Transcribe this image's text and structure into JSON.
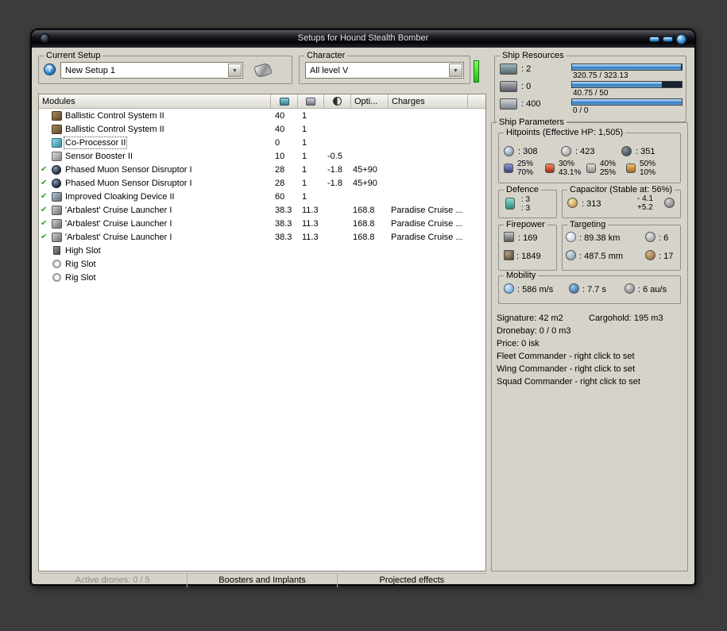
{
  "window": {
    "title": "Setups for Hound Stealth Bomber"
  },
  "current_setup": {
    "label": "Current Setup",
    "value": "New Setup 1"
  },
  "character": {
    "label": "Character",
    "value": "All level V"
  },
  "ship_resources": {
    "label": "Ship Resources",
    "rows": [
      {
        "icon": "cpu-icon",
        "value": ": 2",
        "bar_text": "320.75 / 323.13",
        "fill_pct": 99
      },
      {
        "icon": "powergrid-icon",
        "value": ": 0",
        "bar_text": "40.75 / 50",
        "fill_pct": 82
      },
      {
        "icon": "calibration-icon",
        "value": ": 400",
        "bar_text": "0 / 0",
        "fill_pct": 100
      }
    ]
  },
  "modules_panel": {
    "header": {
      "modules": "Modules",
      "opti": "Opti...",
      "charges": "Charges"
    },
    "rows": [
      {
        "checked": false,
        "selected": false,
        "icon": "bcs",
        "name": "Ballistic Control System II",
        "cpu": "40",
        "pg": "1",
        "misc": "",
        "opti": "",
        "charge": ""
      },
      {
        "checked": false,
        "selected": false,
        "icon": "bcs",
        "name": "Ballistic Control System II",
        "cpu": "40",
        "pg": "1",
        "misc": "",
        "opti": "",
        "charge": ""
      },
      {
        "checked": false,
        "selected": true,
        "icon": "coproc",
        "name": "Co-Processor II",
        "cpu": "0",
        "pg": "1",
        "misc": "",
        "opti": "",
        "charge": ""
      },
      {
        "checked": false,
        "selected": false,
        "icon": "sensor",
        "name": "Sensor Booster II",
        "cpu": "10",
        "pg": "1",
        "misc": "-0.5",
        "opti": "",
        "charge": ""
      },
      {
        "checked": true,
        "selected": false,
        "icon": "disruptor",
        "name": "Phased Muon Sensor Disruptor I",
        "cpu": "28",
        "pg": "1",
        "misc": "-1.8",
        "opti": "45+90",
        "charge": ""
      },
      {
        "checked": true,
        "selected": false,
        "icon": "disruptor",
        "name": "Phased Muon Sensor Disruptor I",
        "cpu": "28",
        "pg": "1",
        "misc": "-1.8",
        "opti": "45+90",
        "charge": ""
      },
      {
        "checked": true,
        "selected": false,
        "icon": "cloak",
        "name": "Improved Cloaking Device II",
        "cpu": "60",
        "pg": "1",
        "misc": "",
        "opti": "",
        "charge": ""
      },
      {
        "checked": true,
        "selected": false,
        "icon": "launcher",
        "name": "'Arbalest' Cruise Launcher I",
        "cpu": "38.3",
        "pg": "11.3",
        "misc": "",
        "opti": "168.8",
        "charge": "Paradise Cruise ..."
      },
      {
        "checked": true,
        "selected": false,
        "icon": "launcher",
        "name": "'Arbalest' Cruise Launcher I",
        "cpu": "38.3",
        "pg": "11.3",
        "misc": "",
        "opti": "168.8",
        "charge": "Paradise Cruise ..."
      },
      {
        "checked": true,
        "selected": false,
        "icon": "launcher",
        "name": "'Arbalest' Cruise Launcher I",
        "cpu": "38.3",
        "pg": "11.3",
        "misc": "",
        "opti": "168.8",
        "charge": "Paradise Cruise ..."
      },
      {
        "checked": false,
        "selected": false,
        "icon": "highslot",
        "name": "High Slot",
        "cpu": "",
        "pg": "",
        "misc": "",
        "opti": "",
        "charge": ""
      },
      {
        "checked": false,
        "selected": false,
        "icon": "rig",
        "name": "Rig Slot",
        "cpu": "",
        "pg": "",
        "misc": "",
        "opti": "",
        "charge": ""
      },
      {
        "checked": false,
        "selected": false,
        "icon": "rig",
        "name": "Rig Slot",
        "cpu": "",
        "pg": "",
        "misc": "",
        "opti": "",
        "charge": ""
      }
    ],
    "footer_tabs": [
      {
        "label": "Active drones: 0 / 5",
        "disabled": true
      },
      {
        "label": "Boosters and Implants",
        "disabled": false
      },
      {
        "label": "Projected effects",
        "disabled": false
      }
    ]
  },
  "ship_parameters": {
    "label": "Ship Parameters",
    "hitpoints": {
      "label": "Hitpoints (Effective HP: 1,505)",
      "shield": ": 308",
      "armor": ": 423",
      "structure": ": 351",
      "resists": [
        {
          "top": "25%",
          "bottom": "70%"
        },
        {
          "top": "30%",
          "bottom": "43.1%"
        },
        {
          "top": "40%",
          "bottom": "25%"
        },
        {
          "top": "50%",
          "bottom": "10%"
        }
      ]
    },
    "defence": {
      "label": "Defence",
      "value1": ": 3",
      "value2": ": 3"
    },
    "capacitor": {
      "label": "Capacitor (Stable at: 56%)",
      "value": ": 313",
      "out": "- 4.1",
      "in": "+5.2"
    },
    "firepower": {
      "label": "Firepower",
      "volley": ": 169",
      "dps": ": 1849"
    },
    "targeting": {
      "label": "Targeting",
      "range": ": 89.38 km",
      "max_targets": ": 6",
      "scan_res": ": 487.5 mm",
      "sensor_str": ": 17"
    },
    "mobility": {
      "label": "Mobility",
      "speed": ": 586 m/s",
      "agility": ": 7.7 s",
      "warp": ": 6 au/s"
    },
    "signature": "Signature: 42 m2",
    "cargohold": "Cargohold: 195 m3",
    "lines": [
      "Dronebay: 0 / 0 m3",
      "Price: 0 isk",
      "Fleet Commander - right click to set",
      "Wing Commander - right click to set",
      "Squad Commander - right click to set"
    ]
  }
}
